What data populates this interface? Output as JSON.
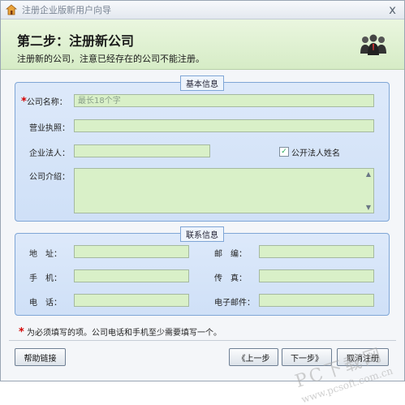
{
  "window": {
    "title": "注册企业版新用户向导",
    "close_glyph": "x"
  },
  "header": {
    "step_title": "第二步：注册新公司",
    "step_subtitle": "注册新的公司，注意已经存在的公司不能注册。"
  },
  "basic_info": {
    "legend": "基本信息",
    "company_name_label": "公司名称：",
    "company_name_placeholder": "最长18个字",
    "required_mark": "*",
    "license_label": "营业执照：",
    "legal_person_label": "企业法人：",
    "public_legal_name_label": "公开法人姓名",
    "public_legal_name_checked": true,
    "intro_label": "公司介绍："
  },
  "contact_info": {
    "legend": "联系信息",
    "address_label": "地　址：",
    "postcode_label": "邮　编：",
    "mobile_label": "手　机：",
    "fax_label": "传　真：",
    "phone_label": "电　话：",
    "email_label": "电子邮件："
  },
  "footer": {
    "required_note": "为必须填写的项。公司电话和手机至少需要填写一个。",
    "help_button": "帮助链接",
    "prev_button": "《上一步",
    "next_button": "下一步》",
    "cancel_button": "取消注册"
  },
  "watermark": {
    "line1": "PC下载网",
    "line2": "www.pcsoft.com.cn"
  },
  "colors": {
    "input_bg": "#d9f0c8",
    "header_bg": "#d6ecc6",
    "fieldset_bg": "#cfe0f7",
    "required": "#d40000"
  }
}
